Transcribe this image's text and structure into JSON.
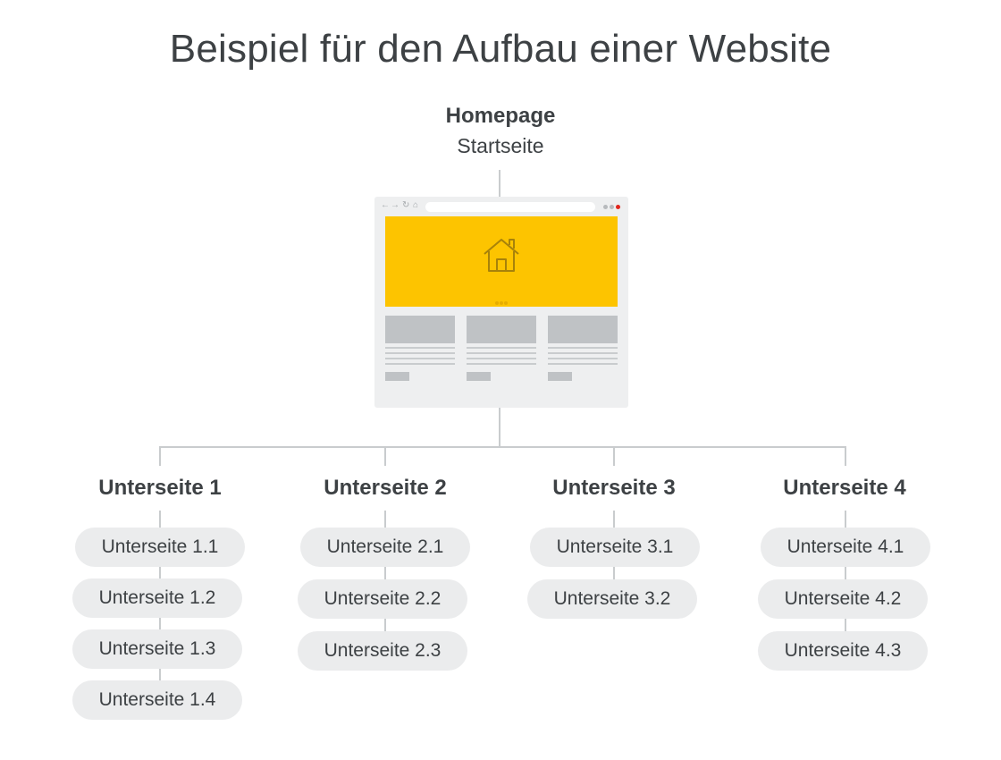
{
  "title": "Beispiel für den Aufbau einer Website",
  "homepage": {
    "label": "Homepage",
    "sublabel": "Startseite"
  },
  "browser_mockup": {
    "hero_color": "#fdc400",
    "icons": [
      "arrow-left-icon",
      "arrow-right-icon",
      "reload-icon",
      "home-icon",
      "house-icon"
    ],
    "close_dot_color": "#e1261c"
  },
  "sections": [
    {
      "label": "Unterseite 1",
      "children": [
        "Unterseite 1.1",
        "Unterseite 1.2",
        "Unterseite 1.3",
        "Unterseite 1.4"
      ]
    },
    {
      "label": "Unterseite 2",
      "children": [
        "Unterseite 2.1",
        "Unterseite 2.2",
        "Unterseite 2.3"
      ]
    },
    {
      "label": "Unterseite 3",
      "children": [
        "Unterseite 3.1",
        "Unterseite 3.2"
      ]
    },
    {
      "label": "Unterseite 4",
      "children": [
        "Unterseite 4.1",
        "Unterseite 4.2",
        "Unterseite 4.3"
      ]
    }
  ],
  "colors": {
    "text": "#3d4144",
    "pill_background": "#ebeced",
    "connector": "#c9ccce"
  }
}
